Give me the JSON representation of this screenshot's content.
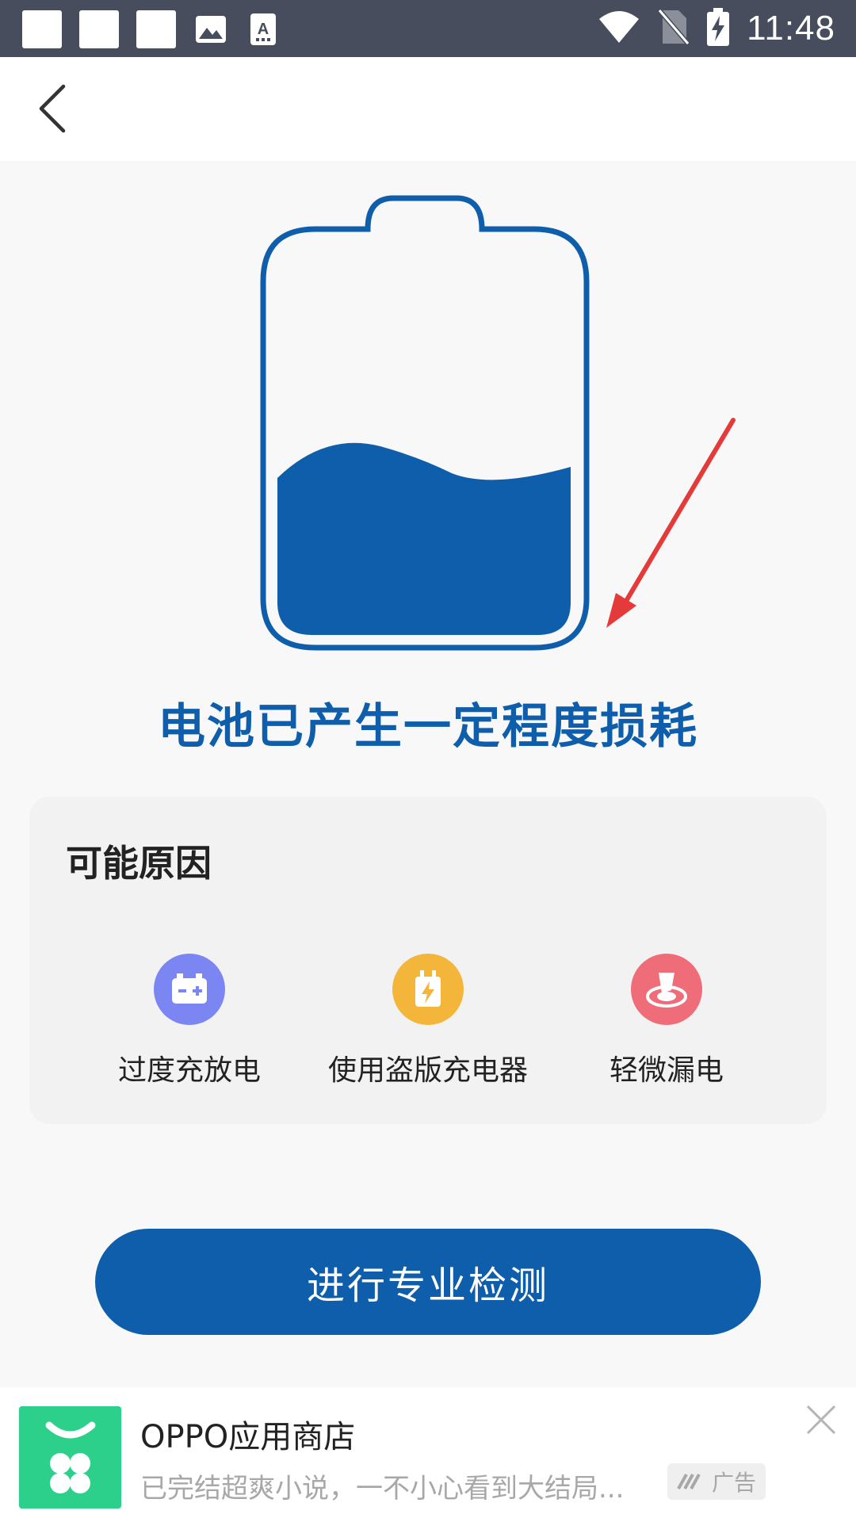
{
  "status_bar": {
    "time": "11:48",
    "left_icons": [
      "notification-square-icon",
      "notification-square-icon",
      "notification-square-icon",
      "image-icon",
      "text-app-icon"
    ],
    "right_icons": [
      "wifi-icon",
      "no-sim-icon",
      "battery-charging-icon"
    ]
  },
  "header": {
    "back_icon": "chevron-left-icon"
  },
  "illustration": {
    "battery_level": 0.5,
    "battery_color": "#0e5eab",
    "arrow_color": "#e53a3a"
  },
  "headline": "电池已产生一定程度损耗",
  "reasons": {
    "title": "可能原因",
    "items": [
      {
        "label": "过度充放电",
        "icon": "battery-charge-icon",
        "color": "#7b86f2"
      },
      {
        "label": "使用盗版充电器",
        "icon": "charger-icon",
        "color": "#f4b63a"
      },
      {
        "label": "轻微漏电",
        "icon": "leak-icon",
        "color": "#ef6d79"
      }
    ]
  },
  "primary_button": {
    "label": "进行专业检测"
  },
  "ad": {
    "title": "OPPO应用商店",
    "description": "已完结超爽小说，一不小心看到大结局...",
    "badge": "广告"
  },
  "colors": {
    "accent": "#0e5eab",
    "status_bar_bg": "#474d5c"
  }
}
